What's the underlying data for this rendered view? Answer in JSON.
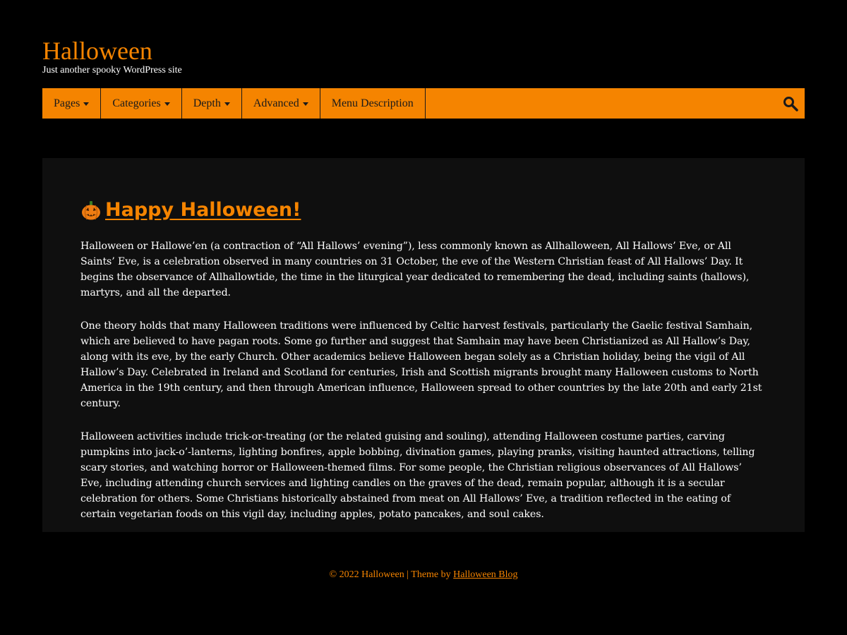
{
  "site": {
    "title": "Halloween",
    "tagline": "Just another spooky WordPress site"
  },
  "nav": {
    "items": [
      {
        "label": "Pages",
        "dropdown": true
      },
      {
        "label": "Categories",
        "dropdown": true
      },
      {
        "label": "Depth",
        "dropdown": true
      },
      {
        "label": "Advanced",
        "dropdown": true
      },
      {
        "label": "Menu Description",
        "dropdown": false
      }
    ],
    "search_icon": "search-icon"
  },
  "post": {
    "emoji_icon": "jack-o-lantern-icon",
    "title": "Happy Halloween!",
    "paragraphs": [
      "Halloween or Hallowe’en (a contraction of “All Hallows’ evening”), less commonly known as Allhalloween, All Hallows’ Eve, or All Saints’ Eve, is a celebration observed in many countries on 31 October, the eve of the Western Christian feast of All Hallows’ Day. It begins the observance of Allhallowtide, the time in the liturgical year dedicated to remembering the dead, including saints (hallows), martyrs, and all the departed.",
      "One theory holds that many Halloween traditions were influenced by Celtic harvest festivals, particularly the Gaelic festival Samhain, which are believed to have pagan roots. Some go further and suggest that Samhain may have been Christianized as All Hallow’s Day, along with its eve, by the early Church. Other academics believe Halloween began solely as a Christian holiday, being the vigil of All Hallow’s Day. Celebrated in Ireland and Scotland for centuries, Irish and Scottish migrants brought many Halloween customs to North America in the 19th century, and then through American influence, Halloween spread to other countries by the late 20th and early 21st century.",
      "Halloween activities include trick-or-treating (or the related guising and souling), attending Halloween costume parties, carving pumpkins into jack-o’-lanterns, lighting bonfires, apple bobbing, divination games, playing pranks, visiting haunted attractions, telling scary stories, and watching horror or Halloween-themed films. For some people, the Christian religious observances of All Hallows’ Eve, including attending church services and lighting candles on the graves of the dead, remain popular, although it is a secular celebration for others. Some Christians historically abstained from meat on All Hallows’ Eve, a tradition reflected in the eating of certain vegetarian foods on this vigil day, including apples, potato pancakes, and soul cakes."
    ]
  },
  "footer": {
    "copyright": "© 2022 Halloween | Theme by ",
    "theme_link": "Halloween Blog"
  },
  "colors": {
    "accent": "#f58400",
    "background": "#000000",
    "content_bg": "#0f0f0f",
    "text": "#ffffff"
  }
}
